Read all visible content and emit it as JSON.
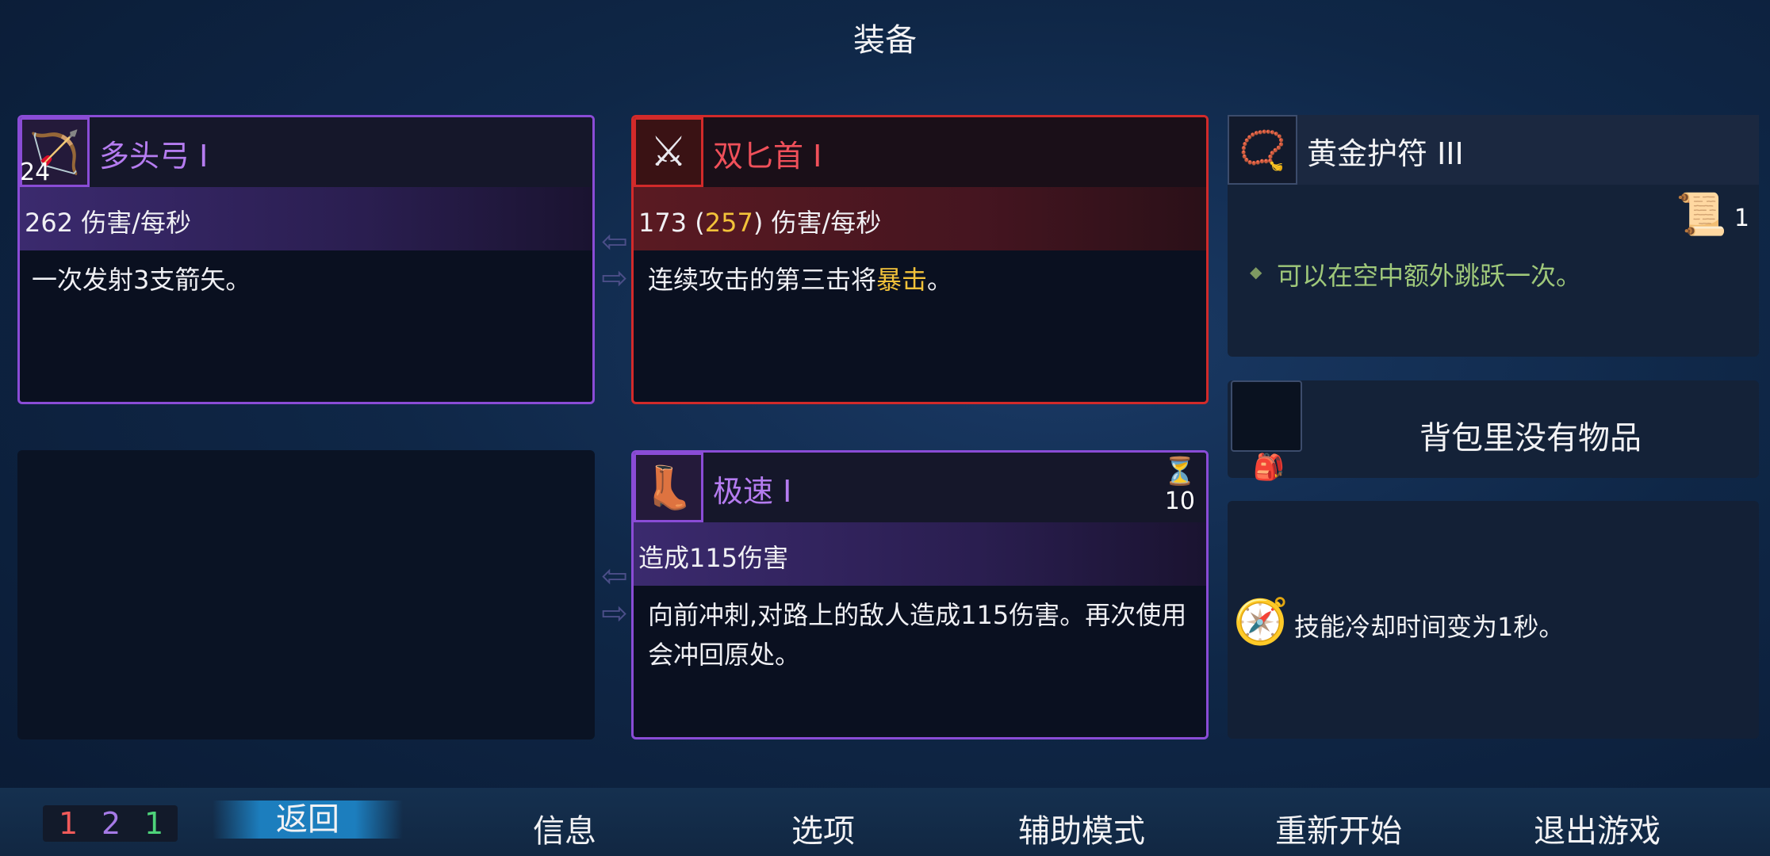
{
  "header": {
    "title": "装备"
  },
  "weapons": {
    "slot1": {
      "icon": "crossbow-icon",
      "name": "多头弓 I",
      "count": "24",
      "stat": "262 伤害/每秒",
      "desc": "一次发射3支箭矢。"
    },
    "slot2": {
      "icon": "twin-daggers-icon",
      "name": "双匕首 I",
      "stat_pre": "173 (",
      "stat_hl": "257",
      "stat_post": ") 伤害/每秒",
      "desc_pre": "连续攻击的第三击将",
      "desc_hl": "暴击",
      "desc_post": "。"
    },
    "skill": {
      "icon": "speed-boots-icon",
      "name": "极速 I",
      "cooldown": "10",
      "stat": "造成115伤害",
      "desc": "向前冲刺,对路上的敌人造成115伤害。再次使用会冲回原处。"
    }
  },
  "amulet": {
    "icon": "amulet-icon",
    "name": "黄金护符 III",
    "scroll_count": "1",
    "desc": "可以在空中额外跳跃一次。"
  },
  "backpack": {
    "empty_text": "背包里没有物品"
  },
  "mutation": {
    "icon": "mutation-icon",
    "text": "技能冷却时间变为1秒。"
  },
  "counters": {
    "red": "1",
    "purple": "2",
    "green": "1"
  },
  "colors": {
    "red": "#f05a5a",
    "purple": "#a57ae6",
    "green": "#4ed37a",
    "accent": "#f2c23a"
  },
  "menu": {
    "back": "返回",
    "info": "信息",
    "options": "选项",
    "assist": "辅助模式",
    "restart": "重新开始",
    "quit": "退出游戏"
  }
}
